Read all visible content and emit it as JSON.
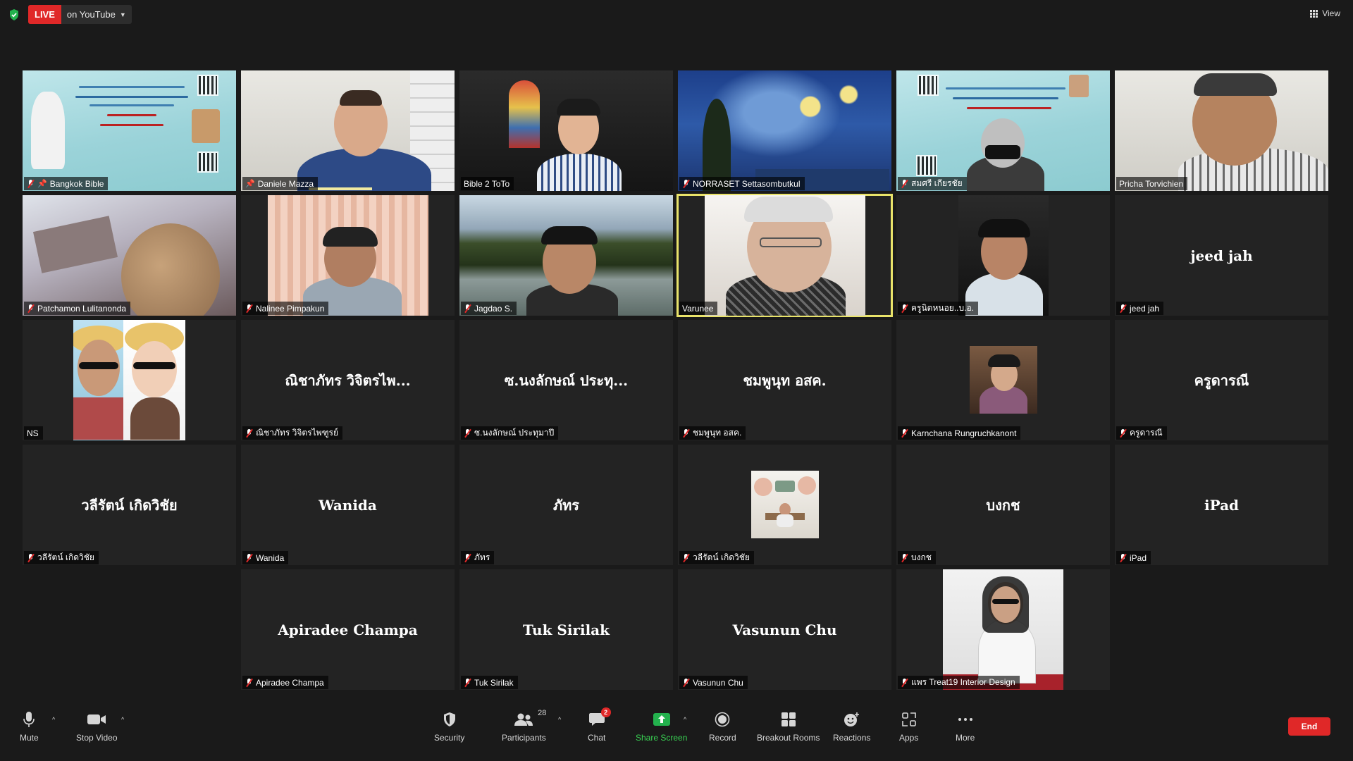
{
  "topbar": {
    "live_label": "LIVE",
    "live_destination": "on YouTube",
    "view_label": "View"
  },
  "participants": [
    {
      "name": "Bangkok Bible",
      "center": "",
      "pinned": true
    },
    {
      "name": "Daniele Mazza",
      "center": "",
      "pinned": true
    },
    {
      "name": "Bible 2 ToTo",
      "center": ""
    },
    {
      "name": "NORRASET Settasombutkul",
      "center": ""
    },
    {
      "name": "สมศรี เกียรชัย",
      "center": ""
    },
    {
      "name": "Pricha Torvichien",
      "center": ""
    },
    {
      "name": "Patchamon Lulitanonda",
      "center": ""
    },
    {
      "name": "Nalinee  Pimpakun",
      "center": ""
    },
    {
      "name": "Jagdao S.",
      "center": ""
    },
    {
      "name": "Varunee",
      "center": ""
    },
    {
      "name": "ครูนิตหนอย..บ.อ.",
      "center": ""
    },
    {
      "name": "jeed jah",
      "center": "jeed jah"
    },
    {
      "name": "NS",
      "center": ""
    },
    {
      "name": "ณิชาภัทร วิจิตรไพฑูรย์",
      "center": "ณิชาภัทร วิจิตรไพ..."
    },
    {
      "name": "ซ.นงลักษณ์ ประทุมาปี",
      "center": "ซ.นงลักษณ์ ประทุ..."
    },
    {
      "name": "ชมพูนุท อสค.",
      "center": "ชมพูนุท อสค."
    },
    {
      "name": "Karnchana Rungruchkanont",
      "center": ""
    },
    {
      "name": "ครูดารณี",
      "center": "ครูดารณี"
    },
    {
      "name": "วลีรัตน์  เกิดวิชัย",
      "center": "วลีรัตน์  เกิดวิชัย"
    },
    {
      "name": "Wanida",
      "center": "Wanida"
    },
    {
      "name": "ภัทร",
      "center": "ภัทร"
    },
    {
      "name": "วลีรัตน์ เกิดวิชัย",
      "center": ""
    },
    {
      "name": "บงกช",
      "center": "บงกช"
    },
    {
      "name": "iPad",
      "center": "iPad"
    },
    {
      "name": "Apiradee Champa",
      "center": "Apiradee Champa"
    },
    {
      "name": "Tuk Sirilak",
      "center": "Tuk Sirilak"
    },
    {
      "name": "Vasunun Chu",
      "center": "Vasunun Chu"
    },
    {
      "name": "แพร Treat19 Interior Design",
      "center": ""
    }
  ],
  "toolbar": {
    "mute": "Mute",
    "stop_video": "Stop Video",
    "security": "Security",
    "participants": "Participants",
    "participants_count": "28",
    "chat": "Chat",
    "chat_badge": "2",
    "share_screen": "Share Screen",
    "record": "Record",
    "breakout_rooms": "Breakout Rooms",
    "reactions": "Reactions",
    "apps": "Apps",
    "more": "More",
    "end": "End"
  },
  "colors": {
    "live_red": "#e02828",
    "share_green": "#39d353",
    "speaker_outline": "#e9e36a",
    "tile_bg": "#232323",
    "page_bg": "#1a1a1a"
  }
}
